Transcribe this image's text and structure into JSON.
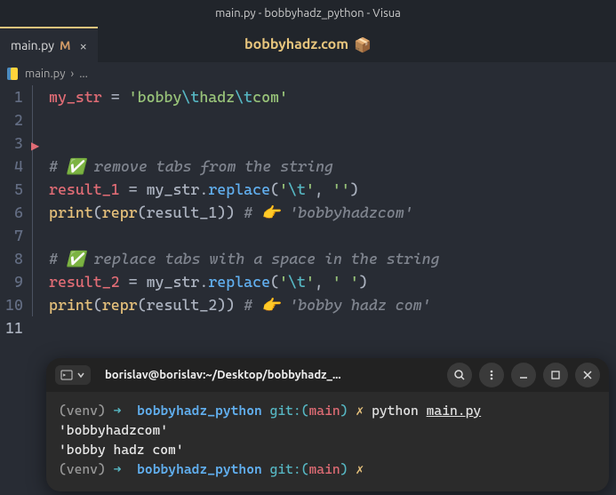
{
  "titlebar": "main.py - bobbyhadz_python - Visua",
  "tab": {
    "label": "main.py",
    "modified": "M",
    "close": "×"
  },
  "watermark": "bobbyhadz.com",
  "breadcrumb": {
    "file": "main.py",
    "sep": "›",
    "more": "..."
  },
  "lines": {
    "n1": "1",
    "n2": "2",
    "n3": "3",
    "n4": "4",
    "n5": "5",
    "n6": "6",
    "n7": "7",
    "n8": "8",
    "n9": "9",
    "n10": "10",
    "n11": "11"
  },
  "code": {
    "l1_var": "my_str",
    "l1_eq": " = ",
    "l1_s1": "'bobby",
    "l1_e1": "\\t",
    "l1_s2": "hadz",
    "l1_e2": "\\t",
    "l1_s3": "com'",
    "l4_cmt": "# ✅ remove tabs from the string",
    "l5_var": "result_1",
    "l5_eq": " = ",
    "l5_obj": "my_str",
    "l5_dot": ".",
    "l5_fn": "replace",
    "l5_open": "(",
    "l5_a1q": "'",
    "l5_a1e": "\\t",
    "l5_a1q2": "'",
    "l5_comma": ", ",
    "l5_a2": "''",
    "l5_close": ")",
    "l6_print": "print",
    "l6_open": "(",
    "l6_repr": "repr",
    "l6_open2": "(",
    "l6_arg": "result_1",
    "l6_close2": ")",
    "l6_close": ")",
    "l6_cmt": "  # 👉 'bobbyhadzcom'",
    "l8_cmt": "# ✅ replace tabs with a space in the string",
    "l9_var": "result_2",
    "l9_eq": " = ",
    "l9_obj": "my_str",
    "l9_dot": ".",
    "l9_fn": "replace",
    "l9_open": "(",
    "l9_a1q": "'",
    "l9_a1e": "\\t",
    "l9_a1q2": "'",
    "l9_comma": ", ",
    "l9_a2": "' '",
    "l9_close": ")",
    "l10_print": "print",
    "l10_open": "(",
    "l10_repr": "repr",
    "l10_open2": "(",
    "l10_arg": "result_2",
    "l10_close2": ")",
    "l10_close": ")",
    "l10_cmt": "  # 👉 'bobby hadz com'"
  },
  "terminal": {
    "title": "borislav@borislav:~/Desktop/bobbyhadz_...",
    "venv": "(venv)",
    "arrow": "➜",
    "dir": "bobbyhadz_python",
    "git_label": "git:(",
    "branch": "main",
    "git_close": ")",
    "x": "✗",
    "cmd_python": "python",
    "cmd_file": "main.py",
    "out1": "'bobbyhadzcom'",
    "out2": "'bobby hadz com'"
  }
}
